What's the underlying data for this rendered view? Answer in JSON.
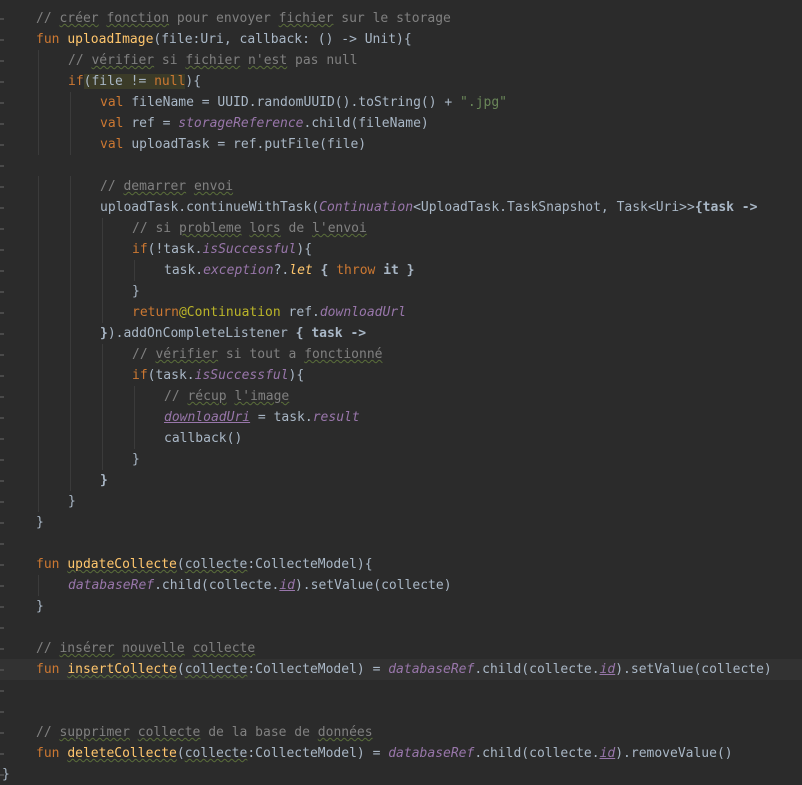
{
  "editor": {
    "lines": [
      {
        "indent": 1,
        "tokens": [
          {
            "t": "// ",
            "c": "cm"
          },
          {
            "t": "créer",
            "c": "cm ul"
          },
          {
            "t": " ",
            "c": "cm"
          },
          {
            "t": "fonction",
            "c": "cm ul"
          },
          {
            "t": " pour envoyer ",
            "c": "cm"
          },
          {
            "t": "fichier",
            "c": "cm ul"
          },
          {
            "t": " sur le storage",
            "c": "cm"
          }
        ]
      },
      {
        "indent": 1,
        "tokens": [
          {
            "t": "fun ",
            "c": "kw"
          },
          {
            "t": "uploadImage",
            "c": "fn"
          },
          {
            "t": "(file:Uri, callback: () -> Unit){",
            "c": ""
          }
        ]
      },
      {
        "indent": 2,
        "tokens": [
          {
            "t": "// ",
            "c": "cm"
          },
          {
            "t": "vérifier",
            "c": "cm ul"
          },
          {
            "t": " si ",
            "c": "cm"
          },
          {
            "t": "fichier",
            "c": "cm ul"
          },
          {
            "t": " ",
            "c": "cm"
          },
          {
            "t": "n'est",
            "c": "cm ul"
          },
          {
            "t": " pas null",
            "c": "cm"
          }
        ]
      },
      {
        "indent": 2,
        "tokens": [
          {
            "t": "if",
            "c": "kw"
          },
          {
            "t": "(",
            "c": "hl"
          },
          {
            "t": "file != ",
            "c": "hl"
          },
          {
            "t": "null",
            "c": "kw hl"
          },
          {
            "t": "){",
            "c": ""
          }
        ]
      },
      {
        "indent": 3,
        "tokens": [
          {
            "t": "val ",
            "c": "kw"
          },
          {
            "t": "fileName = UUID.randomUUID().toString() + ",
            "c": ""
          },
          {
            "t": "\".jpg\"",
            "c": "str"
          }
        ]
      },
      {
        "indent": 3,
        "tokens": [
          {
            "t": "val ",
            "c": "kw"
          },
          {
            "t": "ref = ",
            "c": ""
          },
          {
            "t": "storageReference",
            "c": "prop"
          },
          {
            "t": ".child(fileName)",
            "c": ""
          }
        ]
      },
      {
        "indent": 3,
        "tokens": [
          {
            "t": "val ",
            "c": "kw"
          },
          {
            "t": "uploadTask = ref.putFile(file)",
            "c": ""
          }
        ]
      },
      {
        "indent": 0,
        "tokens": []
      },
      {
        "indent": 3,
        "tokens": [
          {
            "t": "// ",
            "c": "cm"
          },
          {
            "t": "demarrer",
            "c": "cm ul"
          },
          {
            "t": " ",
            "c": "cm"
          },
          {
            "t": "envoi",
            "c": "cm ul"
          }
        ]
      },
      {
        "indent": 3,
        "tokens": [
          {
            "t": "uploadTask.continueWithTask(",
            "c": ""
          },
          {
            "t": "Continuation",
            "c": "prop"
          },
          {
            "t": "<UploadTask.TaskSnapshot, Task<Uri>>",
            "c": ""
          },
          {
            "t": "{task ->",
            "c": "bold"
          }
        ]
      },
      {
        "indent": 4,
        "tokens": [
          {
            "t": "// si ",
            "c": "cm"
          },
          {
            "t": "probleme",
            "c": "cm ul"
          },
          {
            "t": " ",
            "c": "cm"
          },
          {
            "t": "lors",
            "c": "cm ul"
          },
          {
            "t": " de ",
            "c": "cm"
          },
          {
            "t": "l'envoi",
            "c": "cm ul"
          }
        ]
      },
      {
        "indent": 4,
        "tokens": [
          {
            "t": "if",
            "c": "kw"
          },
          {
            "t": "(!task.",
            "c": ""
          },
          {
            "t": "isSuccessful",
            "c": "prop"
          },
          {
            "t": "){",
            "c": ""
          }
        ]
      },
      {
        "indent": 5,
        "tokens": [
          {
            "t": "task.",
            "c": ""
          },
          {
            "t": "exception",
            "c": "prop"
          },
          {
            "t": "?.",
            "c": ""
          },
          {
            "t": "let",
            "c": "fn-it"
          },
          {
            "t": " { ",
            "c": "bold"
          },
          {
            "t": "throw ",
            "c": "kw"
          },
          {
            "t": "it }",
            "c": "bold"
          }
        ]
      },
      {
        "indent": 4,
        "tokens": [
          {
            "t": "}",
            "c": ""
          }
        ]
      },
      {
        "indent": 4,
        "tokens": [
          {
            "t": "return",
            "c": "kw"
          },
          {
            "t": "@Continuation",
            "c": "ann"
          },
          {
            "t": " ref.",
            "c": ""
          },
          {
            "t": "downloadUrl",
            "c": "prop"
          }
        ]
      },
      {
        "indent": 3,
        "tokens": [
          {
            "t": "}",
            "c": "bold"
          },
          {
            "t": ").addOnCompleteListener ",
            "c": ""
          },
          {
            "t": "{ task ->",
            "c": "bold"
          }
        ]
      },
      {
        "indent": 4,
        "tokens": [
          {
            "t": "// ",
            "c": "cm"
          },
          {
            "t": "vérifier",
            "c": "cm ul"
          },
          {
            "t": " si tout a ",
            "c": "cm"
          },
          {
            "t": "fonctionné",
            "c": "cm ul"
          }
        ]
      },
      {
        "indent": 4,
        "tokens": [
          {
            "t": "if",
            "c": "kw"
          },
          {
            "t": "(task.",
            "c": ""
          },
          {
            "t": "isSuccessful",
            "c": "prop"
          },
          {
            "t": "){",
            "c": ""
          }
        ]
      },
      {
        "indent": 5,
        "tokens": [
          {
            "t": "// ",
            "c": "cm"
          },
          {
            "t": "récup",
            "c": "cm ul"
          },
          {
            "t": " ",
            "c": "cm"
          },
          {
            "t": "l'image",
            "c": "cm ul"
          }
        ]
      },
      {
        "indent": 5,
        "tokens": [
          {
            "t": "downloadUri",
            "c": "prop lnk"
          },
          {
            "t": " = task.",
            "c": ""
          },
          {
            "t": "result",
            "c": "prop"
          }
        ]
      },
      {
        "indent": 5,
        "tokens": [
          {
            "t": "callback()",
            "c": ""
          }
        ]
      },
      {
        "indent": 4,
        "tokens": [
          {
            "t": "}",
            "c": ""
          }
        ]
      },
      {
        "indent": 3,
        "tokens": [
          {
            "t": "}",
            "c": "bold"
          }
        ]
      },
      {
        "indent": 2,
        "tokens": [
          {
            "t": "}",
            "c": ""
          }
        ]
      },
      {
        "indent": 1,
        "tokens": [
          {
            "t": "}",
            "c": ""
          }
        ]
      },
      {
        "indent": 0,
        "tokens": []
      },
      {
        "indent": 1,
        "tokens": [
          {
            "t": "fun ",
            "c": "kw"
          },
          {
            "t": "updateCollecte",
            "c": "fn ul"
          },
          {
            "t": "(",
            "c": ""
          },
          {
            "t": "collecte",
            "c": "ul"
          },
          {
            "t": ":CollecteModel){",
            "c": ""
          }
        ]
      },
      {
        "indent": 2,
        "tokens": [
          {
            "t": "databaseRef",
            "c": "prop"
          },
          {
            "t": ".child(collecte.",
            "c": ""
          },
          {
            "t": "id",
            "c": "prop lnk"
          },
          {
            "t": ").setValue(collecte)",
            "c": ""
          }
        ]
      },
      {
        "indent": 1,
        "tokens": [
          {
            "t": "}",
            "c": ""
          }
        ]
      },
      {
        "indent": 0,
        "tokens": []
      },
      {
        "indent": 1,
        "tokens": [
          {
            "t": "// ",
            "c": "cm"
          },
          {
            "t": "insérer",
            "c": "cm ul"
          },
          {
            "t": " ",
            "c": "cm"
          },
          {
            "t": "nouvelle",
            "c": "cm ul"
          },
          {
            "t": " ",
            "c": "cm"
          },
          {
            "t": "collecte",
            "c": "cm ul"
          }
        ]
      },
      {
        "indent": 1,
        "current": true,
        "tokens": [
          {
            "t": "fun ",
            "c": "kw"
          },
          {
            "t": "insertCollecte",
            "c": "fn ul"
          },
          {
            "t": "(",
            "c": ""
          },
          {
            "t": "collecte",
            "c": "ul"
          },
          {
            "t": ":CollecteModel) = ",
            "c": ""
          },
          {
            "t": "databaseRef",
            "c": "prop"
          },
          {
            "t": ".child(collecte.",
            "c": ""
          },
          {
            "t": "id",
            "c": "prop lnk"
          },
          {
            "t": ").setValue(collecte)",
            "c": ""
          }
        ]
      },
      {
        "indent": 0,
        "tokens": []
      },
      {
        "indent": 0,
        "tokens": []
      },
      {
        "indent": 1,
        "tokens": [
          {
            "t": "// ",
            "c": "cm"
          },
          {
            "t": "supprimer",
            "c": "cm ul"
          },
          {
            "t": " ",
            "c": "cm"
          },
          {
            "t": "collecte",
            "c": "cm ul"
          },
          {
            "t": " de la base de ",
            "c": "cm"
          },
          {
            "t": "données",
            "c": "cm ul"
          }
        ]
      },
      {
        "indent": 1,
        "tokens": [
          {
            "t": "fun ",
            "c": "kw"
          },
          {
            "t": "deleteCollecte",
            "c": "fn ul"
          },
          {
            "t": "(",
            "c": ""
          },
          {
            "t": "collecte",
            "c": "ul"
          },
          {
            "t": ":CollecteModel) = ",
            "c": ""
          },
          {
            "t": "databaseRef",
            "c": "prop"
          },
          {
            "t": ".child(collecte.",
            "c": ""
          },
          {
            "t": "id",
            "c": "prop lnk"
          },
          {
            "t": ").removeValue()",
            "c": ""
          }
        ]
      },
      {
        "indent": 0,
        "tokens": [
          {
            "t": "}",
            "c": ""
          }
        ]
      }
    ]
  }
}
